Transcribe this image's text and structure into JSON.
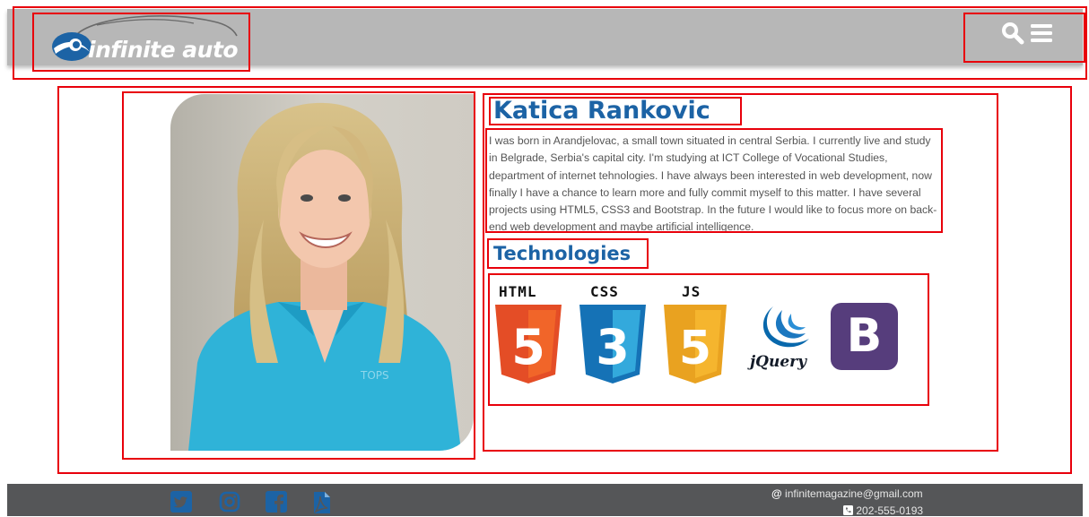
{
  "header": {
    "logo_text": "infinite auto",
    "search_icon": "search-icon",
    "menu_icon": "hamburger-menu-icon"
  },
  "profile": {
    "name": "Katica Rankovic",
    "bio": "I was born in Arandjelovac, a small town situated in central Serbia. I currently live and study in Belgrade, Serbia's capital city. I'm studying at ICT College of Vocational Studies, department of internet tehnologies. I have always been interested in web development, now finally I have a chance to learn more and fully commit myself to this matter. I have several projects using HTML5, CSS3 and Bootstrap. In the future I would like to focus more on back-end web development and maybe artificial intelligence."
  },
  "technologies": {
    "heading": "Technologies",
    "items": [
      {
        "label": "HTML",
        "number": "5",
        "icon": "html5-icon",
        "color": "#e44d26",
        "shade": "#f16529"
      },
      {
        "label": "CSS",
        "number": "3",
        "icon": "css3-icon",
        "color": "#1572b6",
        "shade": "#33a9dc"
      },
      {
        "label": "JS",
        "number": "5",
        "icon": "js-icon",
        "color": "#e9a220",
        "shade": "#f5b52e"
      },
      {
        "label": "jQuery",
        "icon": "jquery-icon",
        "color": "#0868ac"
      },
      {
        "label": "B",
        "icon": "bootstrap-icon",
        "color": "#563d7c"
      }
    ]
  },
  "footer": {
    "social": [
      "twitter-icon",
      "instagram-icon",
      "facebook-icon",
      "pdf-icon"
    ],
    "email": "infinitemagazine@gmail.com",
    "phone": "202-555-0193",
    "at_symbol": "@"
  },
  "colors": {
    "header_bg": "#b7b7b7",
    "footer_bg": "#555658",
    "heading": "#1c63a5",
    "highlight_box": "#e8000b"
  }
}
